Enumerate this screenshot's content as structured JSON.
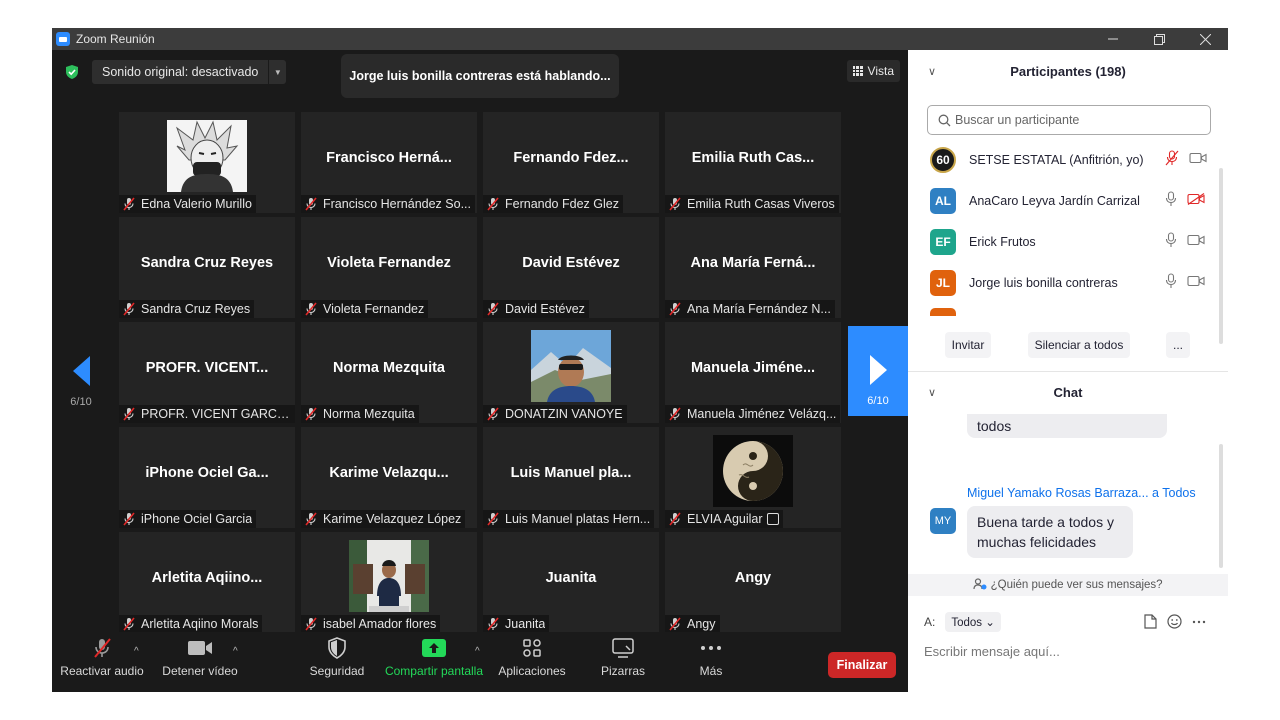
{
  "window": {
    "title": "Zoom Reunión"
  },
  "meeting": {
    "audio_dropdown": "Sonido original: desactivado",
    "speaking_banner": "Jorge luis bonilla contreras está hablando...",
    "view_label": "Vista",
    "page_prev": "6/10",
    "page_next": "6/10"
  },
  "tiles": [
    {
      "big": "",
      "foot": "Edna Valerio Murillo",
      "photo": "anime-avatar"
    },
    {
      "big": "Francisco  Herná...",
      "foot": "Francisco Hernández So..."
    },
    {
      "big": "Fernando  Fdez...",
      "foot": "Fernando Fdez Glez"
    },
    {
      "big": "Emilia Ruth Cas...",
      "foot": "Emilia Ruth Casas Viveros"
    },
    {
      "big": "Sandra Cruz Reyes",
      "foot": "Sandra Cruz Reyes"
    },
    {
      "big": "Violeta Fernandez",
      "foot": "Violeta Fernandez"
    },
    {
      "big": "David Estévez",
      "foot": "David Estévez"
    },
    {
      "big": "Ana María  Ferná...",
      "foot": "Ana María Fernández N..."
    },
    {
      "big": "PROFR.  VICENT...",
      "foot": "PROFR. VICENT GARCIA ..."
    },
    {
      "big": "Norma Mezquita",
      "foot": "Norma Mezquita"
    },
    {
      "big": "",
      "foot": "DONATZIN VANOYE",
      "photo": "mountain-selfie"
    },
    {
      "big": "Manuela  Jiméne...",
      "foot": "Manuela Jiménez Velázq..."
    },
    {
      "big": "iPhone  Ociel  Ga...",
      "foot": "iPhone Ociel Garcia"
    },
    {
      "big": "Karime  Velazqu...",
      "foot": "Karime Velazquez López"
    },
    {
      "big": "Luis Manuel  pla...",
      "foot": "Luis Manuel platas Hern..."
    },
    {
      "big": "",
      "foot": "ELVIA Aguilar",
      "photo": "yin-yang"
    },
    {
      "big": "Arletita  Aqiino...",
      "foot": "Arletita Aqiino Morals"
    },
    {
      "big": "",
      "foot": "isabel Amador flores",
      "photo": "person-seated"
    },
    {
      "big": "Juanita",
      "foot": "Juanita"
    },
    {
      "big": "Angy",
      "foot": "Angy"
    }
  ],
  "toolbar": {
    "unmute": "Reactivar audio",
    "stop_video": "Detener vídeo",
    "security": "Seguridad",
    "share": "Compartir pantalla",
    "apps": "Aplicaciones",
    "whiteboards": "Pizarras",
    "more": "Más",
    "end": "Finalizar"
  },
  "participants": {
    "header": "Participantes (198)",
    "search_placeholder": "Buscar un participante",
    "list": [
      {
        "initials": "60",
        "name": "SETSE ESTATAL (Anfitrión, yo)",
        "color": "#1a1a1a"
      },
      {
        "initials": "AL",
        "name": "AnaCaro Leyva Jardín Carrizal",
        "color": "#2f80c3"
      },
      {
        "initials": "EF",
        "name": "Erick Frutos",
        "color": "#1ea58c"
      },
      {
        "initials": "JL",
        "name": "Jorge luis bonilla contreras",
        "color": "#e0620d"
      }
    ],
    "invite": "Invitar",
    "mute_all": "Silenciar a todos",
    "more": "..."
  },
  "chat": {
    "header": "Chat",
    "prev_message": "todos",
    "sender": "Miguel Yamako Rosas Barraza...",
    "to": "a Todos",
    "sender_initials": "MY",
    "message": "Buena tarde a todos y muchas felicidades",
    "who_sees": "¿Quién puede ver sus mensajes?",
    "to_label": "A:",
    "to_value": "Todos",
    "input_placeholder": "Escribir mensaje aquí..."
  },
  "colors": {
    "accent": "#2d8cff",
    "end": "#cc2727",
    "share_green": "#23d959",
    "muted_red": "#e02828"
  }
}
